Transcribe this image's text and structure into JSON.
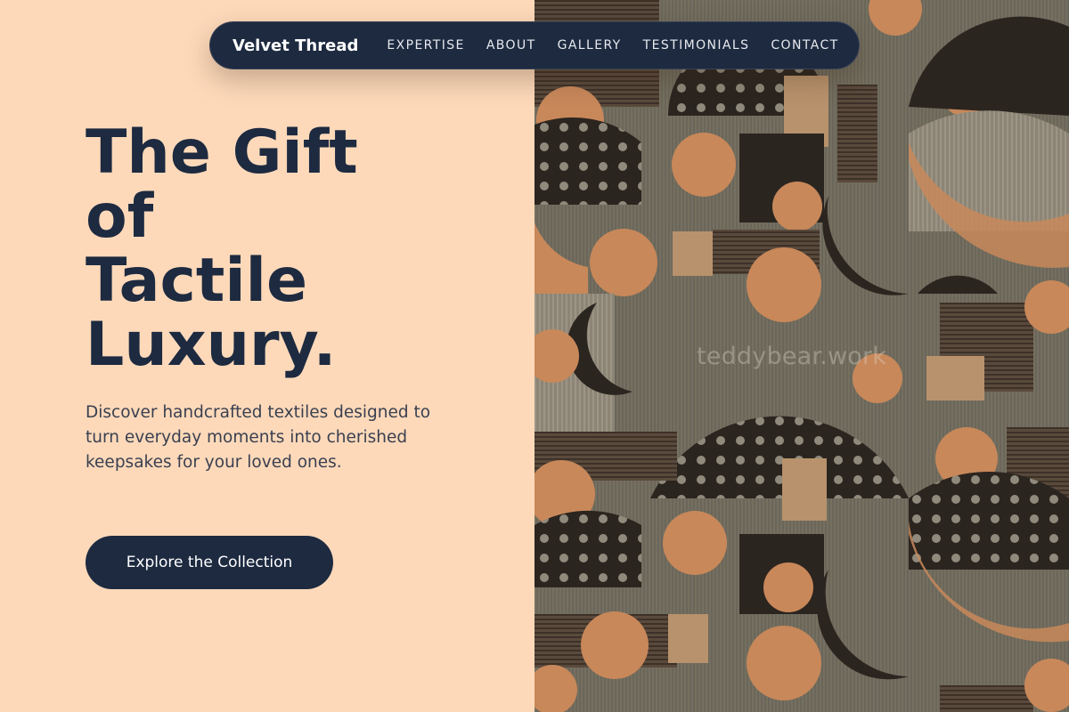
{
  "nav": {
    "brand": "Velvet Thread",
    "links": [
      "EXPERTISE",
      "ABOUT",
      "GALLERY",
      "TESTIMONIALS",
      "CONTACT"
    ]
  },
  "hero": {
    "title_lines": [
      "The Gift",
      "of",
      "Tactile",
      "Luxury."
    ],
    "description": "Discover handcrafted textiles designed to turn everyday moments into cherished keepsakes for your loved ones.",
    "cta_label": "Explore the Collection"
  },
  "image": {
    "watermark": "teddybear.work",
    "subject": "woven textile with geometric circles and crescents"
  },
  "colors": {
    "page_background": "#fdd9ba",
    "navy": "#1d2a40",
    "body_text": "#3a4050",
    "fabric_base": "#6b665b",
    "fabric_orange": "#c8885a",
    "fabric_dark": "#2b2520",
    "fabric_tan": "#b8926c"
  }
}
